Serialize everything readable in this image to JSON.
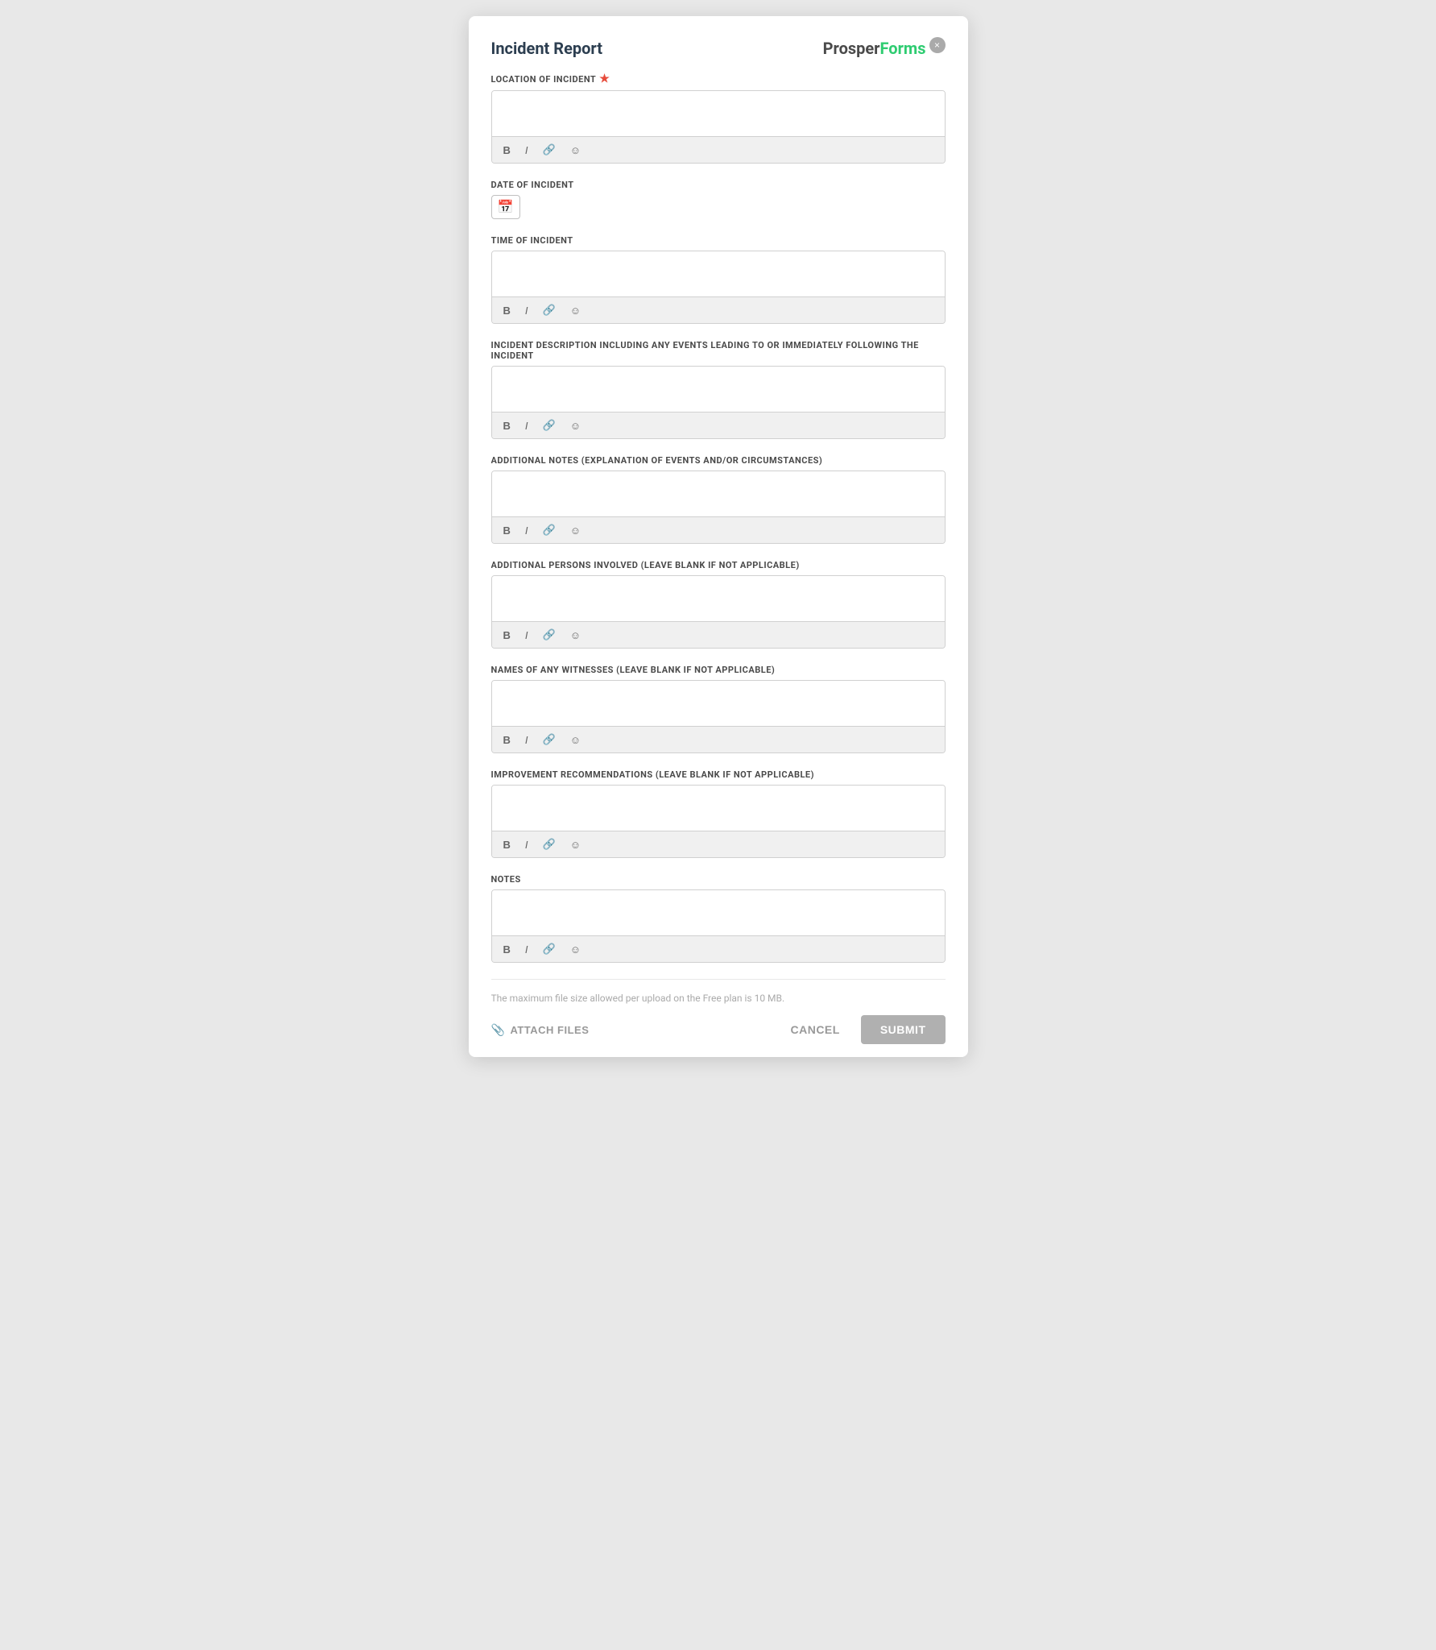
{
  "modal": {
    "title": "Incident Report",
    "close_label": "×"
  },
  "brand": {
    "prosper": "Prosper",
    "forms": "Forms"
  },
  "fields": [
    {
      "id": "location",
      "label": "LOCATION OF INCIDENT",
      "required": true,
      "type": "rich-text",
      "value": ""
    },
    {
      "id": "date",
      "label": "DATE OF INCIDENT",
      "required": false,
      "type": "date",
      "value": ""
    },
    {
      "id": "time",
      "label": "TIME OF INCIDENT",
      "required": false,
      "type": "rich-text",
      "value": ""
    },
    {
      "id": "description",
      "label": "INCIDENT DESCRIPTION INCLUDING ANY EVENTS LEADING TO OR IMMEDIATELY FOLLOWING THE INCIDENT",
      "required": false,
      "type": "rich-text",
      "value": ""
    },
    {
      "id": "additional_notes",
      "label": "ADDITIONAL NOTES (EXPLANATION OF EVENTS AND/OR CIRCUMSTANCES)",
      "required": false,
      "type": "rich-text",
      "value": ""
    },
    {
      "id": "additional_persons",
      "label": "ADDITIONAL PERSONS INVOLVED (LEAVE BLANK IF NOT APPLICABLE)",
      "required": false,
      "type": "rich-text",
      "value": ""
    },
    {
      "id": "witnesses",
      "label": "NAMES OF ANY WITNESSES (LEAVE BLANK IF NOT APPLICABLE)",
      "required": false,
      "type": "rich-text",
      "value": ""
    },
    {
      "id": "improvement",
      "label": "IMPROVEMENT RECOMMENDATIONS (LEAVE BLANK IF NOT APPLICABLE)",
      "required": false,
      "type": "rich-text",
      "value": ""
    },
    {
      "id": "notes",
      "label": "NOTES",
      "required": false,
      "type": "rich-text",
      "value": ""
    }
  ],
  "toolbar": {
    "bold": "B",
    "italic": "I",
    "link": "🔗",
    "emoji": "☺"
  },
  "footer": {
    "file_size_note": "The maximum file size allowed per upload on the Free plan is 10 MB.",
    "attach_label": "ATTACH FILES",
    "cancel_label": "CANCEL",
    "submit_label": "SUBMIT"
  }
}
